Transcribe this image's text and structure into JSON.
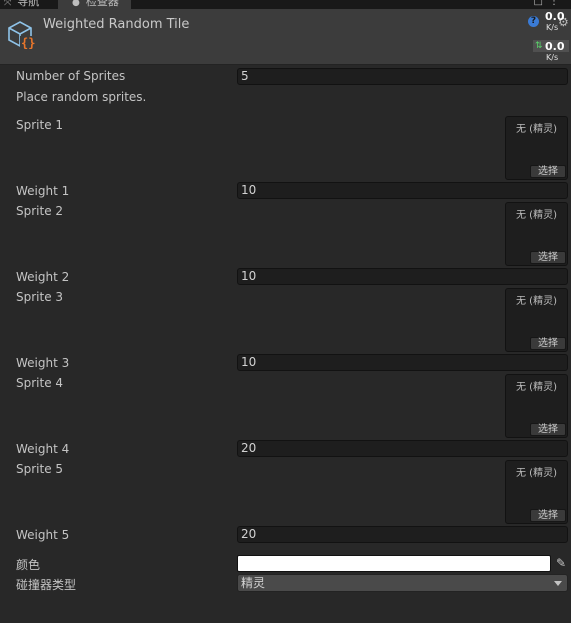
{
  "tabs": {
    "nav_label": "导航",
    "inspector_label": "检查器"
  },
  "header": {
    "title": "Weighted Random Tile",
    "net_up": "0.0",
    "net_up_unit": "K/s",
    "net_down": "0.0",
    "net_down_unit": "K/s"
  },
  "inspector": {
    "number_of_sprites_label": "Number of Sprites",
    "number_of_sprites_value": "5",
    "description": "Place random sprites.",
    "entries": [
      {
        "sprite_label": "Sprite 1",
        "none_text": "无 (精灵)",
        "select_label": "选择",
        "weight_label": "Weight 1",
        "weight_value": "10"
      },
      {
        "sprite_label": "Sprite 2",
        "none_text": "无 (精灵)",
        "select_label": "选择",
        "weight_label": "Weight 2",
        "weight_value": "10"
      },
      {
        "sprite_label": "Sprite 3",
        "none_text": "无 (精灵)",
        "select_label": "选择",
        "weight_label": "Weight 3",
        "weight_value": "10"
      },
      {
        "sprite_label": "Sprite 4",
        "none_text": "无 (精灵)",
        "select_label": "选择",
        "weight_label": "Weight 4",
        "weight_value": "20"
      },
      {
        "sprite_label": "Sprite 5",
        "none_text": "无 (精灵)",
        "select_label": "选择",
        "weight_label": "Weight 5",
        "weight_value": "20"
      }
    ],
    "color_label": "颜色",
    "color_value": "#ffffff",
    "collider_label": "碰撞器类型",
    "collider_value": "精灵"
  }
}
